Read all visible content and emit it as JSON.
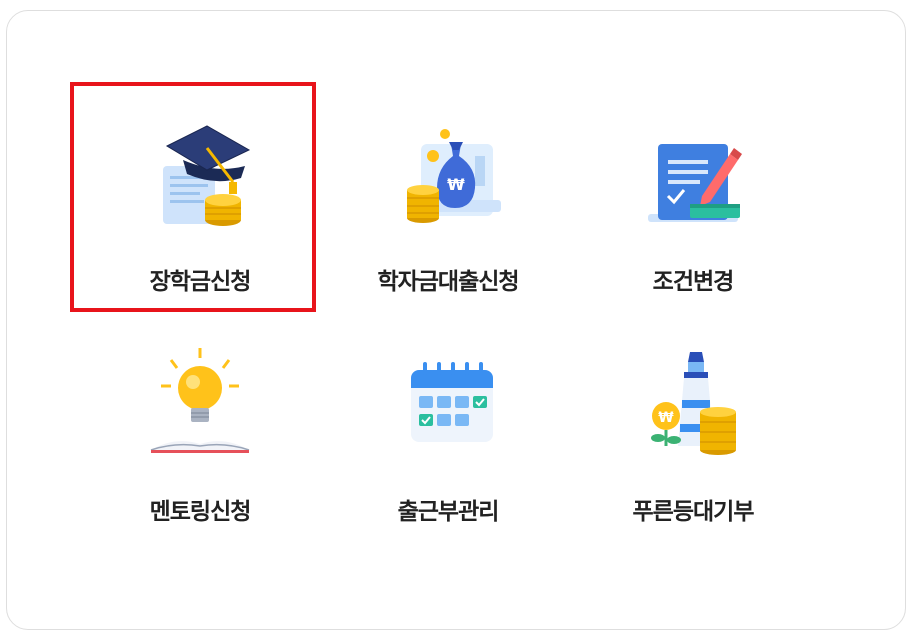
{
  "menu": {
    "items": [
      {
        "label": "장학금신청",
        "icon": "graduation-cap-coins-icon"
      },
      {
        "label": "학자금대출신청",
        "icon": "money-bag-coins-icon"
      },
      {
        "label": "조건변경",
        "icon": "document-pen-icon"
      },
      {
        "label": "멘토링신청",
        "icon": "lightbulb-book-icon"
      },
      {
        "label": "출근부관리",
        "icon": "calendar-icon"
      },
      {
        "label": "푸른등대기부",
        "icon": "lighthouse-coins-icon"
      }
    ],
    "selected_index": 0
  },
  "colors": {
    "highlight": "#e8141b",
    "panel_border": "#dedede",
    "label": "#222222"
  }
}
